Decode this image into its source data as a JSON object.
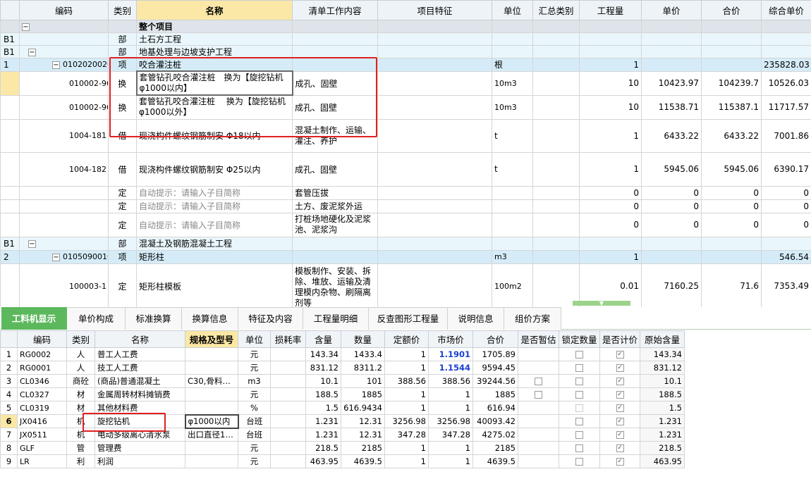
{
  "top": {
    "headers": [
      "编码",
      "类别",
      "名称",
      "清单工作内容",
      "项目特征",
      "单位",
      "汇总类别",
      "工程量",
      "单价",
      "合价",
      "综合单价"
    ],
    "rows": [
      {
        "rn": "",
        "toggle": "−",
        "code": "",
        "type": "",
        "name": "整个项目",
        "work": "",
        "feat": "",
        "unit": "",
        "qty": "",
        "price": "",
        "total": "",
        "comp": ""
      },
      {
        "rn": "B1",
        "toggle": "",
        "code": "",
        "type": "部",
        "name": "土石方工程",
        "work": "",
        "feat": "",
        "unit": "",
        "qty": "",
        "price": "",
        "total": "",
        "comp": ""
      },
      {
        "rn": "B1",
        "toggle": "−",
        "code": "",
        "type": "部",
        "name": "地基处理与边坡支护工程",
        "work": "",
        "feat": "",
        "unit": "",
        "qty": "",
        "price": "",
        "total": "",
        "comp": ""
      },
      {
        "rn": "1",
        "toggle": "−",
        "code": "010202002001",
        "type": "项",
        "name": "咬合灌注桩",
        "work": "",
        "feat": "",
        "unit": "根",
        "qty": "1",
        "price": "",
        "total": "",
        "comp": "235828.03"
      },
      {
        "rn": "",
        "toggle": "",
        "code": "010002-96",
        "type": "换",
        "name": "套管钻孔咬合灌注桩　换为【旋挖钻机 φ1000以内】",
        "work": "成孔、固壁",
        "feat": "",
        "unit": "10m3",
        "qty": "10",
        "price": "10423.97",
        "total": "104239.7",
        "comp": "10526.03"
      },
      {
        "rn": "",
        "toggle": "",
        "code": "010002-96",
        "type": "换",
        "name": "套管钻孔咬合灌注桩　 换为【旋挖钻机 φ1000以外】",
        "work": "成孔、固壁",
        "feat": "",
        "unit": "10m3",
        "qty": "10",
        "price": "11538.71",
        "total": "115387.1",
        "comp": "11717.57"
      },
      {
        "rn": "",
        "toggle": "",
        "code": "1004-181",
        "type": "借",
        "name": "现浇构件螺纹钢筋制安 Φ18以内",
        "work": "混凝土制作、运输、灌注、养护",
        "feat": "",
        "unit": "t",
        "qty": "1",
        "price": "6433.22",
        "total": "6433.22",
        "comp": "7001.86"
      },
      {
        "rn": "",
        "toggle": "",
        "code": "1004-182",
        "type": "借",
        "name": "现浇构件螺纹钢筋制安 Φ25以内",
        "work": "成孔、固壁",
        "feat": "",
        "unit": "t",
        "qty": "1",
        "price": "5945.06",
        "total": "5945.06",
        "comp": "6390.17"
      },
      {
        "rn": "",
        "toggle": "",
        "code": "",
        "type": "定",
        "name": "自动提示：请输入子目简称",
        "work": "套管压拔",
        "feat": "",
        "unit": "",
        "qty": "0",
        "price": "0",
        "total": "0",
        "comp": "0"
      },
      {
        "rn": "",
        "toggle": "",
        "code": "",
        "type": "定",
        "name": "自动提示：请输入子目简称",
        "work": "土方、废泥浆外运",
        "feat": "",
        "unit": "",
        "qty": "0",
        "price": "0",
        "total": "0",
        "comp": "0"
      },
      {
        "rn": "",
        "toggle": "",
        "code": "",
        "type": "定",
        "name": "自动提示：请输入子目简称",
        "work": "打桩场地硬化及泥浆池、泥浆沟",
        "feat": "",
        "unit": "",
        "qty": "0",
        "price": "0",
        "total": "0",
        "comp": "0"
      },
      {
        "rn": "B1",
        "toggle": "−",
        "code": "",
        "type": "部",
        "name": "混凝土及钢筋混凝土工程",
        "work": "",
        "feat": "",
        "unit": "",
        "qty": "",
        "price": "",
        "total": "",
        "comp": ""
      },
      {
        "rn": "2",
        "toggle": "−",
        "code": "010509001001",
        "type": "项",
        "name": "矩形柱",
        "work": "",
        "feat": "",
        "unit": "m3",
        "qty": "1",
        "price": "",
        "total": "",
        "comp": "546.54"
      },
      {
        "rn": "",
        "toggle": "",
        "code": "100003-1",
        "type": "定",
        "name": "矩形柱模板",
        "work": "模板制作、安装、拆除、堆放、运输及清理模内杂物、刷隔离剂等",
        "feat": "",
        "unit": "100m2",
        "qty": "0.01",
        "price": "7160.25",
        "total": "71.6",
        "comp": "7353.49"
      }
    ]
  },
  "tabs": [
    "工料机显示",
    "单价构成",
    "标准换算",
    "换算信息",
    "特征及内容",
    "工程量明细",
    "反查图形工程量",
    "说明信息",
    "组价方案"
  ],
  "bottom": {
    "headers": [
      "编码",
      "类别",
      "名称",
      "规格及型号",
      "单位",
      "损耗率",
      "含量",
      "数量",
      "定额价",
      "市场价",
      "合价",
      "是否暂估",
      "锁定数量",
      "是否计价",
      "原始含量"
    ],
    "rows": [
      {
        "rn": "1",
        "code": "RG0002",
        "type": "人",
        "name": "普工人工费",
        "spec": "",
        "unit": "元",
        "loss": "",
        "content": "143.34",
        "count": "1433.4",
        "quota": "1",
        "market": "1.1901",
        "total": "1705.89",
        "est": "",
        "lock": "box",
        "price": "check",
        "orig": "143.34"
      },
      {
        "rn": "2",
        "code": "RG0001",
        "type": "人",
        "name": "技工人工费",
        "spec": "",
        "unit": "元",
        "loss": "",
        "content": "831.12",
        "count": "8311.2",
        "quota": "1",
        "market": "1.1544",
        "total": "9594.45",
        "est": "",
        "lock": "box",
        "price": "check",
        "orig": "831.12"
      },
      {
        "rn": "3",
        "code": "CL0346",
        "type": "商砼",
        "name": "(商品)普通混凝土",
        "spec": "C30,骨料…",
        "unit": "m3",
        "loss": "",
        "content": "10.1",
        "count": "101",
        "quota": "388.56",
        "market": "388.56",
        "total": "39244.56",
        "est": "box",
        "lock": "box",
        "price": "check",
        "orig": "10.1"
      },
      {
        "rn": "4",
        "code": "CL0327",
        "type": "材",
        "name": "金属周转材料摊销费",
        "spec": "",
        "unit": "元",
        "loss": "",
        "content": "188.5",
        "count": "1885",
        "quota": "1",
        "market": "1",
        "total": "1885",
        "est": "box",
        "lock": "box",
        "price": "check",
        "orig": "188.5"
      },
      {
        "rn": "5",
        "code": "CL0319",
        "type": "材",
        "name": "其他材料费",
        "spec": "",
        "unit": "%",
        "loss": "",
        "content": "1.5",
        "count": "616.9434",
        "quota": "1",
        "market": "1",
        "total": "616.94",
        "est": "",
        "lock": "dis",
        "price": "check",
        "orig": "1.5"
      },
      {
        "rn": "6",
        "code": "JX0416",
        "type": "机",
        "name": "旋挖钻机",
        "spec": "φ1000以内",
        "unit": "台班",
        "loss": "",
        "content": "1.231",
        "count": "12.31",
        "quota": "3256.98",
        "market": "3256.98",
        "total": "40093.42",
        "est": "",
        "lock": "box",
        "price": "check",
        "orig": "1.231"
      },
      {
        "rn": "7",
        "code": "JX0511",
        "type": "机",
        "name": "电动多级离心清水泵",
        "spec": "出口直径1…",
        "unit": "台班",
        "loss": "",
        "content": "1.231",
        "count": "12.31",
        "quota": "347.28",
        "market": "347.28",
        "total": "4275.02",
        "est": "",
        "lock": "box",
        "price": "check",
        "orig": "1.231"
      },
      {
        "rn": "8",
        "code": "GLF",
        "type": "管",
        "name": "管理费",
        "spec": "",
        "unit": "元",
        "loss": "",
        "content": "218.5",
        "count": "2185",
        "quota": "1",
        "market": "1",
        "total": "2185",
        "est": "",
        "lock": "box",
        "price": "check",
        "orig": "218.5"
      },
      {
        "rn": "9",
        "code": "LR",
        "type": "利",
        "name": "利润",
        "spec": "",
        "unit": "元",
        "loss": "",
        "content": "463.95",
        "count": "4639.5",
        "quota": "1",
        "market": "1",
        "total": "4639.5",
        "est": "",
        "lock": "box",
        "price": "check",
        "orig": "463.95"
      }
    ]
  },
  "icons": {
    "collapse": "minus-toggle-icon",
    "check": "checkmark-icon",
    "handle": "chevron-down-icon"
  },
  "colors": {
    "header_hl": "#fbe8a6",
    "row_blue": "#d5ecf8",
    "tab_active": "#5cb85c",
    "annot_red": "#e02020",
    "market_blue": "#1a3fd1"
  }
}
